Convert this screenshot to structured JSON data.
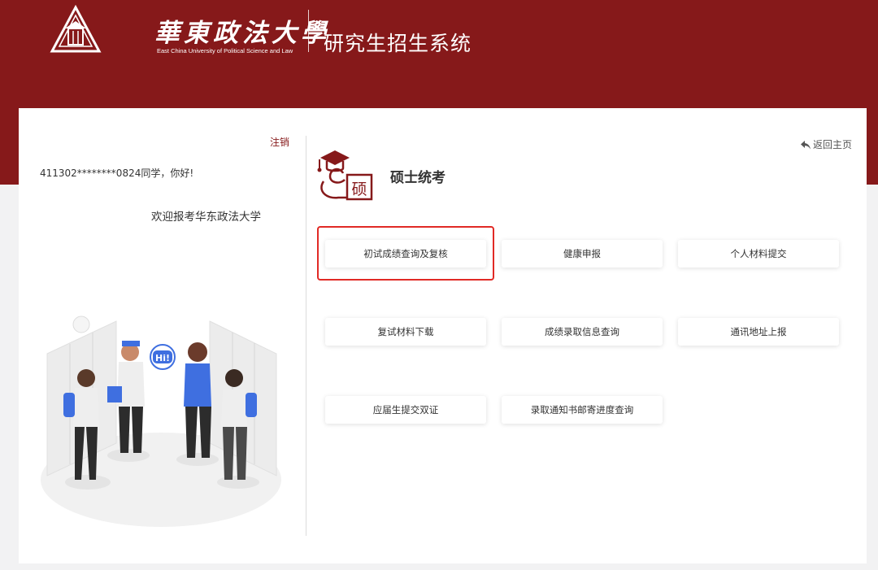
{
  "header": {
    "logo_name": "華東政法大學",
    "logo_english": "East China University of Political Science and Law",
    "system_title": "研究生招生系统"
  },
  "colors": {
    "brand": "#86191a",
    "highlight": "#e12a25",
    "background": "#f2f2f3"
  },
  "left_panel": {
    "logout_label": "注销",
    "greeting": "411302********0824同学，你好!",
    "welcome": "欢迎报考华东政法大学",
    "illustration_bubble": "Hi!"
  },
  "right_panel": {
    "back_home_label": "返回主页",
    "back_home_icon": "reply-arrow-icon",
    "section_icon_label": "硕",
    "section_title": "硕士统考",
    "buttons": [
      {
        "label": "初试成绩查询及复核"
      },
      {
        "label": "健康申报"
      },
      {
        "label": "个人材料提交"
      },
      {
        "label": "复试材料下载"
      },
      {
        "label": "成绩录取信息查询"
      },
      {
        "label": "通讯地址上报"
      },
      {
        "label": "应届生提交双证"
      },
      {
        "label": "录取通知书邮寄进度查询"
      }
    ]
  }
}
